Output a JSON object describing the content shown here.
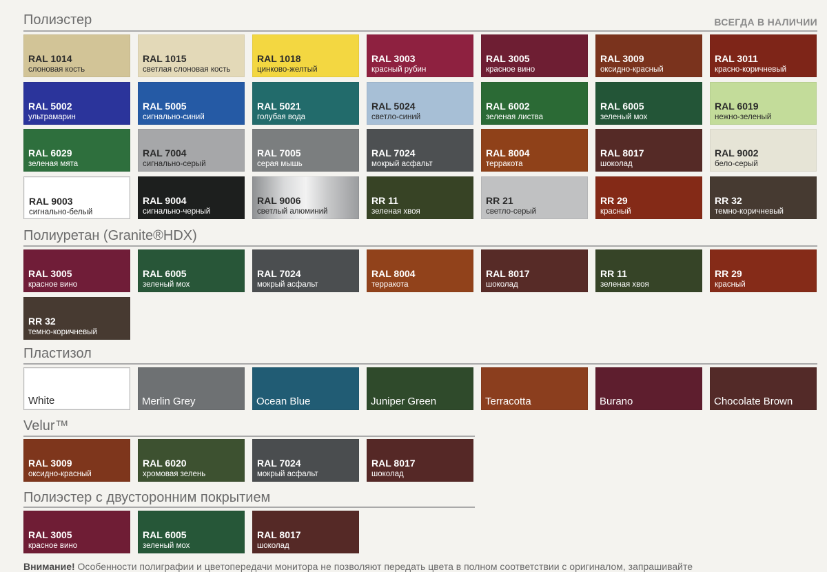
{
  "badge": "ВСЕГДА В НАЛИЧИИ",
  "sections": [
    {
      "title": "Полиэстер",
      "swatches": [
        {
          "code": "RAL 1014",
          "name": "слоновая кость",
          "color": "#d2c497",
          "theme": "light"
        },
        {
          "code": "RAL 1015",
          "name": "светлая слоновая кость",
          "color": "#e3d9b8",
          "theme": "light"
        },
        {
          "code": "RAL 1018",
          "name": "цинково-желтый",
          "color": "#f3d741",
          "theme": "light"
        },
        {
          "code": "RAL 3003",
          "name": "красный рубин",
          "color": "#8e2140",
          "theme": "dark"
        },
        {
          "code": "RAL 3005",
          "name": "красное вино",
          "color": "#6e1e33",
          "theme": "dark"
        },
        {
          "code": "RAL 3009",
          "name": "оксидно-красный",
          "color": "#7a331d",
          "theme": "dark"
        },
        {
          "code": "RAL 3011",
          "name": "красно-коричневый",
          "color": "#7e2518",
          "theme": "dark"
        },
        {
          "code": "RAL 5002",
          "name": "ультрамарин",
          "color": "#2b349b",
          "theme": "dark"
        },
        {
          "code": "RAL 5005",
          "name": "сигнально-синий",
          "color": "#255aa5",
          "theme": "dark"
        },
        {
          "code": "RAL 5021",
          "name": "голубая вода",
          "color": "#226b6b",
          "theme": "dark"
        },
        {
          "code": "RAL 5024",
          "name": "светло-синий",
          "color": "#a7bfd6",
          "theme": "light"
        },
        {
          "code": "RAL 6002",
          "name": "зеленая листва",
          "color": "#2b6a35",
          "theme": "dark"
        },
        {
          "code": "RAL 6005",
          "name": "зеленый мох",
          "color": "#235537",
          "theme": "dark"
        },
        {
          "code": "RAL 6019",
          "name": "нежно-зеленый",
          "color": "#c3dc9a",
          "theme": "light"
        },
        {
          "code": "RAL 6029",
          "name": "зеленая мята",
          "color": "#2e6f3d",
          "theme": "dark"
        },
        {
          "code": "RAL 7004",
          "name": "сигнально-серый",
          "color": "#a6a7a9",
          "theme": "light"
        },
        {
          "code": "RAL 7005",
          "name": "серая мышь",
          "color": "#7b7e7f",
          "theme": "dark"
        },
        {
          "code": "RAL 7024",
          "name": "мокрый асфальт",
          "color": "#4d5052",
          "theme": "dark"
        },
        {
          "code": "RAL 8004",
          "name": "терракота",
          "color": "#8f4119",
          "theme": "dark"
        },
        {
          "code": "RAL 8017",
          "name": "шоколад",
          "color": "#552a26",
          "theme": "dark"
        },
        {
          "code": "RAL 9002",
          "name": "бело-серый",
          "color": "#e6e4d6",
          "theme": "light"
        },
        {
          "code": "RAL 9003",
          "name": "сигнально-белый",
          "color": "#ffffff",
          "theme": "light",
          "bordered": true
        },
        {
          "code": "RAL 9004",
          "name": "сигнально-черный",
          "color": "#1d1f1e",
          "theme": "dark"
        },
        {
          "code": "RAL 9006",
          "name": "светлый алюминий",
          "color": "#b9bbbd",
          "theme": "light",
          "metallic": true
        },
        {
          "code": "RR 11",
          "name": "зеленая хвоя",
          "color": "#374325",
          "theme": "dark"
        },
        {
          "code": "RR 21",
          "name": "светло-серый",
          "color": "#c0c1c2",
          "theme": "light"
        },
        {
          "code": "RR 29",
          "name": "красный",
          "color": "#842a17",
          "theme": "dark"
        },
        {
          "code": "RR 32",
          "name": "темно-коричневый",
          "color": "#463a31",
          "theme": "dark"
        }
      ]
    },
    {
      "title": "Полиуретан (Granite®HDX)",
      "swatches": [
        {
          "code": "RAL 3005",
          "name": "красное вино",
          "color": "#701d38",
          "theme": "dark"
        },
        {
          "code": "RAL 6005",
          "name": "зеленый мох",
          "color": "#285638",
          "theme": "dark"
        },
        {
          "code": "RAL 7024",
          "name": "мокрый асфальт",
          "color": "#4b4e50",
          "theme": "dark"
        },
        {
          "code": "RAL 8004",
          "name": "терракота",
          "color": "#91421b",
          "theme": "dark"
        },
        {
          "code": "RAL 8017",
          "name": "шоколад",
          "color": "#572b27",
          "theme": "dark"
        },
        {
          "code": "RR 11",
          "name": "зеленая хвоя",
          "color": "#364427",
          "theme": "dark"
        },
        {
          "code": "RR 29",
          "name": "красный",
          "color": "#852b18",
          "theme": "dark"
        },
        {
          "code": "RR 32",
          "name": "темно-коричневый",
          "color": "#473a31",
          "theme": "dark"
        }
      ]
    },
    {
      "title": "Пластизол",
      "swatches": [
        {
          "label": "White",
          "color": "#ffffff",
          "theme": "light",
          "bordered": true
        },
        {
          "label": "Merlin Grey",
          "color": "#6e7173",
          "theme": "dark"
        },
        {
          "label": "Ocean Blue",
          "color": "#215c74",
          "theme": "dark"
        },
        {
          "label": "Juniper Green",
          "color": "#2f4a2b",
          "theme": "dark"
        },
        {
          "label": "Terracotta",
          "color": "#8b3e1e",
          "theme": "dark"
        },
        {
          "label": "Burano",
          "color": "#5e1e2e",
          "theme": "dark"
        },
        {
          "label": "Chocolate Brown",
          "color": "#532a28",
          "theme": "dark"
        }
      ]
    },
    {
      "title": "Velur™",
      "swatches": [
        {
          "code": "RAL 3009",
          "name": "оксидно-красный",
          "color": "#7e361c",
          "theme": "dark"
        },
        {
          "code": "RAL 6020",
          "name": "хромовая зелень",
          "color": "#3d5130",
          "theme": "dark"
        },
        {
          "code": "RAL 7024",
          "name": "мокрый асфальт",
          "color": "#4a4d4f",
          "theme": "dark"
        },
        {
          "code": "RAL 8017",
          "name": "шоколад",
          "color": "#552826",
          "theme": "dark"
        }
      ]
    },
    {
      "title": "Полиэстер с двусторонним покрытием",
      "swatches": [
        {
          "code": "RAL 3005",
          "name": "красное вино",
          "color": "#6f1d35",
          "theme": "dark"
        },
        {
          "code": "RAL 6005",
          "name": "зеленый мох",
          "color": "#265738",
          "theme": "dark"
        },
        {
          "code": "RAL 8017",
          "name": "шоколад",
          "color": "#552926",
          "theme": "dark"
        }
      ]
    }
  ],
  "footer": {
    "bold": "Внимание!",
    "text": " Особенности полиграфии и цветопередачи монитора не позволяют передать цвета в полном соответствии с оригиналом, запрашивайте"
  }
}
